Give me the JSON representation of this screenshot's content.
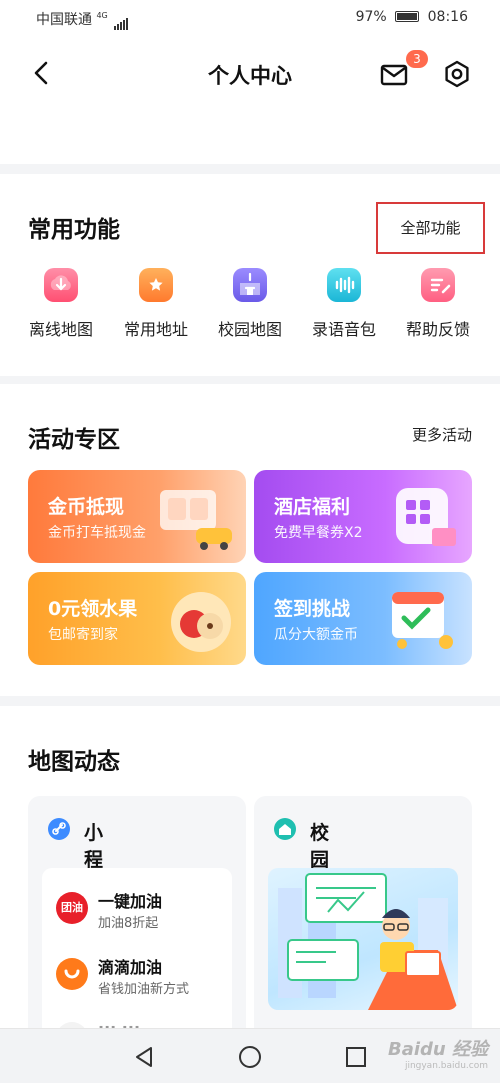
{
  "status": {
    "carrier": "中国联通",
    "network": "4G",
    "battery": "97%",
    "time": "08:16"
  },
  "nav": {
    "title": "个人中心",
    "mail_badge": "3"
  },
  "common": {
    "title": "常用功能",
    "all_label": "全部功能",
    "items": [
      {
        "label": "离线地图",
        "icon": "cloud-download-icon",
        "color": "#ff5a7a"
      },
      {
        "label": "常用地址",
        "icon": "home-star-icon",
        "color": "#ff8a3c"
      },
      {
        "label": "校园地图",
        "icon": "school-icon",
        "color": "#7a6cf5"
      },
      {
        "label": "录语音包",
        "icon": "voice-wave-icon",
        "color": "#22c3e0"
      },
      {
        "label": "帮助反馈",
        "icon": "feedback-icon",
        "color": "#ff6a86"
      }
    ]
  },
  "activity": {
    "title": "活动专区",
    "more_label": "更多活动",
    "cards": [
      {
        "title": "金币抵现",
        "subtitle": "金币打车抵现金"
      },
      {
        "title": "酒店福利",
        "subtitle": "免费早餐券X2"
      },
      {
        "title": "0元领水果",
        "subtitle": "包邮寄到家"
      },
      {
        "title": "签到挑战",
        "subtitle": "瓜分大额金币"
      }
    ]
  },
  "mapfeed": {
    "title": "地图动态",
    "mini_program": {
      "title": "小程序",
      "items": [
        {
          "logo_text": "团油",
          "title": "一键加油",
          "subtitle": "加油8折起"
        },
        {
          "logo_text": "",
          "title": "滴滴加油",
          "subtitle": "省钱加油新方式"
        },
        {
          "logo_text": "",
          "title": "··· ···",
          "subtitle": ""
        }
      ]
    },
    "campus": {
      "title": "校园地图"
    }
  },
  "watermark": {
    "text": "Baidu 经验",
    "sub": "jingyan.baidu.com"
  }
}
